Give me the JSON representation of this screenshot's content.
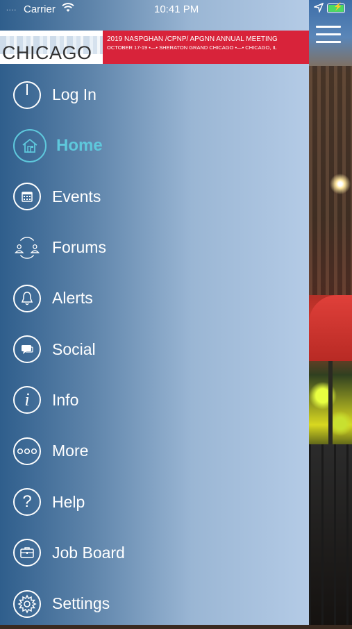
{
  "status_bar": {
    "signal": "....",
    "carrier": "Carrier",
    "time": "10:41 PM"
  },
  "banner": {
    "city": "CHICAGO",
    "line1": "2019 NASPGHAN /CPNP/ APGNN ANNUAL MEETING",
    "line2": "OCTOBER 17-19 •—• SHERATON GRAND CHICAGO •—• CHICAGO, IL",
    "accent_color": "#d8233a"
  },
  "menu": {
    "active_color": "#5ec8dc",
    "items": [
      {
        "label": "Log In",
        "icon": "power-icon"
      },
      {
        "label": "Home",
        "icon": "home-icon",
        "active": true
      },
      {
        "label": "Events",
        "icon": "calendar-icon"
      },
      {
        "label": "Forums",
        "icon": "forums-icon"
      },
      {
        "label": "Alerts",
        "icon": "bell-icon"
      },
      {
        "label": "Social",
        "icon": "chat-icon"
      },
      {
        "label": "Info",
        "icon": "info-icon"
      },
      {
        "label": "More",
        "icon": "more-icon"
      },
      {
        "label": "Help",
        "icon": "help-icon"
      },
      {
        "label": "Job Board",
        "icon": "briefcase-icon"
      },
      {
        "label": "Settings",
        "icon": "gear-icon"
      }
    ]
  }
}
